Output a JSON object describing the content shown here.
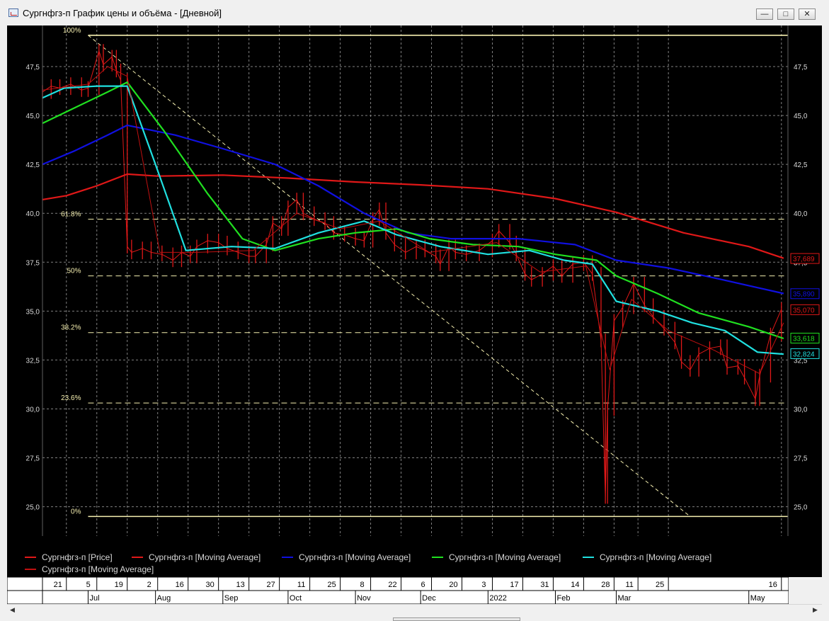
{
  "window": {
    "title": "Сургнфгз-п График цены и объёма - [Дневной]",
    "minimize_icon": "minimize-icon",
    "restore_icon": "restore-icon",
    "close_icon": "close-icon"
  },
  "colors": {
    "background": "#000000",
    "grid": "#808080",
    "price": "#e01818",
    "ma_red": "#e01818",
    "ma_blue": "#1010e0",
    "ma_green": "#20e020",
    "ma_cyan": "#20e0e0",
    "ma_darkred": "#c01010",
    "fib": "#f5efb0",
    "text": "#d8d8d8"
  },
  "chart_data": {
    "type": "line",
    "title": "",
    "y_ticks": [
      "47,5",
      "45,0",
      "42,5",
      "40,0",
      "37,5",
      "35,0",
      "32,5",
      "30,0",
      "27,5",
      "25,0"
    ],
    "y_tick_values": [
      47.5,
      45.0,
      42.5,
      40.0,
      37.5,
      35.0,
      32.5,
      30.0,
      27.5,
      25.0
    ],
    "ylim": [
      23.5,
      49.6
    ],
    "x_tick_days": [
      "21",
      "5",
      "19",
      "2",
      "16",
      "30",
      "13",
      "27",
      "11",
      "25",
      "8",
      "22",
      "6",
      "20",
      "3",
      "17",
      "31",
      "14",
      "28",
      "11",
      "25",
      "16"
    ],
    "x_tick_dates": [
      "2021-06-21",
      "2021-07-05",
      "2021-07-19",
      "2021-08-02",
      "2021-08-16",
      "2021-08-30",
      "2021-09-13",
      "2021-09-27",
      "2021-10-11",
      "2021-10-25",
      "2021-11-08",
      "2021-11-22",
      "2021-12-06",
      "2021-12-20",
      "2022-01-03",
      "2022-01-17",
      "2022-01-31",
      "2022-02-14",
      "2022-02-28",
      "2022-03-11",
      "2022-03-25",
      "2022-05-16"
    ],
    "x_months": [
      "Jul",
      "Aug",
      "Sep",
      "Oct",
      "Nov",
      "Dec",
      "2022",
      "Feb",
      "Mar",
      "May"
    ],
    "x_month_dates": [
      "2021-07-01",
      "2021-08-01",
      "2021-09-01",
      "2021-10-01",
      "2021-11-01",
      "2021-12-01",
      "2022-01-01",
      "2022-02-01",
      "2022-03-01",
      "2022-05-01"
    ],
    "x_range": [
      "2021-06-10",
      "2022-05-19"
    ],
    "fibonacci": {
      "levels": [
        {
          "label": "100%",
          "value": 49.1
        },
        {
          "label": "61.8%",
          "value": 39.7
        },
        {
          "label": "50%",
          "value": 36.8
        },
        {
          "label": "38.2%",
          "value": 33.9
        },
        {
          "label": "23.6%",
          "value": 30.3
        },
        {
          "label": "0%",
          "value": 24.5
        }
      ],
      "trend_line": [
        [
          "2021-07-01",
          49.1
        ],
        [
          "2022-04-04",
          24.5
        ]
      ]
    },
    "series": [
      {
        "name": "Сургнфгз-п [Price]",
        "color": "#e01818",
        "kind": "price",
        "points": [
          [
            "2021-06-10",
            46.2
          ],
          [
            "2021-06-14",
            46.5
          ],
          [
            "2021-06-18",
            46.4
          ],
          [
            "2021-06-23",
            46.6
          ],
          [
            "2021-06-28",
            46.3
          ],
          [
            "2021-07-01",
            46.4
          ],
          [
            "2021-07-06",
            48.3
          ],
          [
            "2021-07-08",
            47.6
          ],
          [
            "2021-07-12",
            48.0
          ],
          [
            "2021-07-14",
            47.3
          ],
          [
            "2021-07-16",
            46.8
          ],
          [
            "2021-07-19",
            38.3
          ],
          [
            "2021-07-21",
            38.0
          ],
          [
            "2021-07-26",
            38.2
          ],
          [
            "2021-07-30",
            38.0
          ],
          [
            "2021-08-04",
            37.9
          ],
          [
            "2021-08-09",
            37.6
          ],
          [
            "2021-08-13",
            38.0
          ],
          [
            "2021-08-17",
            37.8
          ],
          [
            "2021-08-20",
            38.3
          ],
          [
            "2021-08-25",
            38.6
          ],
          [
            "2021-08-30",
            38.5
          ],
          [
            "2021-09-03",
            38.2
          ],
          [
            "2021-09-08",
            38.0
          ],
          [
            "2021-09-13",
            37.8
          ],
          [
            "2021-09-16",
            37.8
          ],
          [
            "2021-09-21",
            38.4
          ],
          [
            "2021-09-24",
            39.5
          ],
          [
            "2021-09-28",
            39.2
          ],
          [
            "2021-10-01",
            40.3
          ],
          [
            "2021-10-05",
            40.7
          ],
          [
            "2021-10-08",
            40.0
          ],
          [
            "2021-10-13",
            39.7
          ],
          [
            "2021-10-18",
            39.5
          ],
          [
            "2021-10-22",
            39.0
          ],
          [
            "2021-10-27",
            38.9
          ],
          [
            "2021-11-01",
            38.7
          ],
          [
            "2021-11-05",
            38.6
          ],
          [
            "2021-11-09",
            39.7
          ],
          [
            "2021-11-12",
            40.2
          ],
          [
            "2021-11-15",
            39.0
          ],
          [
            "2021-11-19",
            38.4
          ],
          [
            "2021-11-24",
            38.0
          ],
          [
            "2021-11-29",
            38.3
          ],
          [
            "2021-12-03",
            38.1
          ],
          [
            "2021-12-08",
            37.8
          ],
          [
            "2021-12-10",
            37.4
          ],
          [
            "2021-12-14",
            38.3
          ],
          [
            "2021-12-17",
            38.0
          ],
          [
            "2021-12-22",
            37.9
          ],
          [
            "2021-12-28",
            38.1
          ],
          [
            "2022-01-03",
            38.6
          ],
          [
            "2022-01-06",
            39.1
          ],
          [
            "2022-01-11",
            38.5
          ],
          [
            "2022-01-14",
            37.9
          ],
          [
            "2022-01-18",
            36.9
          ],
          [
            "2022-01-21",
            36.6
          ],
          [
            "2022-01-26",
            36.9
          ],
          [
            "2022-01-31",
            37.3
          ],
          [
            "2022-02-04",
            36.8
          ],
          [
            "2022-02-09",
            37.4
          ],
          [
            "2022-02-14",
            37.5
          ],
          [
            "2022-02-18",
            36.9
          ],
          [
            "2022-02-22",
            33.5
          ],
          [
            "2022-02-24",
            25.5
          ],
          [
            "2022-02-25",
            30.0
          ],
          [
            "2022-02-28",
            34.5
          ],
          [
            "2022-03-04",
            35.2
          ],
          [
            "2022-03-09",
            36.4
          ],
          [
            "2022-03-14",
            35.3
          ],
          [
            "2022-03-18",
            34.7
          ],
          [
            "2022-03-23",
            34.1
          ],
          [
            "2022-03-28",
            33.4
          ],
          [
            "2022-03-31",
            32.4
          ],
          [
            "2022-04-04",
            32.0
          ],
          [
            "2022-04-08",
            32.8
          ],
          [
            "2022-04-13",
            33.1
          ],
          [
            "2022-04-18",
            33.2
          ],
          [
            "2022-04-21",
            32.1
          ],
          [
            "2022-04-26",
            32.2
          ],
          [
            "2022-04-29",
            31.6
          ],
          [
            "2022-05-04",
            30.5
          ],
          [
            "2022-05-06",
            31.7
          ],
          [
            "2022-05-11",
            33.8
          ],
          [
            "2022-05-16",
            35.1
          ]
        ]
      },
      {
        "name": "Сургнфгз-п [Moving Average]",
        "color": "#e01818",
        "kind": "ma",
        "points": [
          [
            "2021-06-10",
            40.7
          ],
          [
            "2021-06-21",
            40.9
          ],
          [
            "2021-07-05",
            41.4
          ],
          [
            "2021-07-19",
            42.0
          ],
          [
            "2021-08-02",
            41.9
          ],
          [
            "2021-09-01",
            41.95
          ],
          [
            "2021-10-01",
            41.8
          ],
          [
            "2021-11-01",
            41.6
          ],
          [
            "2021-12-01",
            41.45
          ],
          [
            "2022-01-01",
            41.25
          ],
          [
            "2022-02-01",
            40.75
          ],
          [
            "2022-03-01",
            40.05
          ],
          [
            "2022-04-01",
            39.0
          ],
          [
            "2022-05-01",
            38.3
          ],
          [
            "2022-05-17",
            37.7
          ]
        ]
      },
      {
        "name": "Сургнфгз-п [Moving Average]",
        "color": "#1010e0",
        "kind": "ma",
        "points": [
          [
            "2021-06-10",
            42.5
          ],
          [
            "2021-06-25",
            43.2
          ],
          [
            "2021-07-10",
            44.0
          ],
          [
            "2021-07-19",
            44.5
          ],
          [
            "2021-08-10",
            44.0
          ],
          [
            "2021-09-01",
            43.3
          ],
          [
            "2021-09-25",
            42.5
          ],
          [
            "2021-10-15",
            41.4
          ],
          [
            "2021-11-05",
            40.0
          ],
          [
            "2021-11-25",
            39.0
          ],
          [
            "2021-12-15",
            38.7
          ],
          [
            "2022-01-15",
            38.7
          ],
          [
            "2022-02-10",
            38.4
          ],
          [
            "2022-03-01",
            37.6
          ],
          [
            "2022-03-25",
            37.2
          ],
          [
            "2022-04-15",
            36.7
          ],
          [
            "2022-05-01",
            36.3
          ],
          [
            "2022-05-17",
            35.9
          ]
        ]
      },
      {
        "name": "Сургнфгз-п [Moving Average]",
        "color": "#20e020",
        "kind": "ma",
        "points": [
          [
            "2021-06-10",
            44.6
          ],
          [
            "2021-06-25",
            45.4
          ],
          [
            "2021-07-10",
            46.2
          ],
          [
            "2021-07-19",
            46.7
          ],
          [
            "2021-08-05",
            44.2
          ],
          [
            "2021-08-25",
            41.0
          ],
          [
            "2021-09-10",
            38.7
          ],
          [
            "2021-09-25",
            38.1
          ],
          [
            "2021-10-15",
            38.7
          ],
          [
            "2021-11-01",
            39.0
          ],
          [
            "2021-11-20",
            39.2
          ],
          [
            "2021-12-05",
            38.7
          ],
          [
            "2021-12-25",
            38.4
          ],
          [
            "2022-01-15",
            38.3
          ],
          [
            "2022-02-01",
            37.9
          ],
          [
            "2022-02-20",
            37.6
          ],
          [
            "2022-03-01",
            36.8
          ],
          [
            "2022-03-20",
            35.9
          ],
          [
            "2022-04-08",
            34.9
          ],
          [
            "2022-05-01",
            34.2
          ],
          [
            "2022-05-17",
            33.6
          ]
        ]
      },
      {
        "name": "Сургнфгз-п [Moving Average]",
        "color": "#20e0e0",
        "kind": "ma",
        "points": [
          [
            "2021-06-10",
            45.9
          ],
          [
            "2021-06-20",
            46.4
          ],
          [
            "2021-07-05",
            46.5
          ],
          [
            "2021-07-19",
            46.5
          ],
          [
            "2021-08-01",
            42.5
          ],
          [
            "2021-08-15",
            38.1
          ],
          [
            "2021-09-05",
            38.3
          ],
          [
            "2021-09-25",
            38.2
          ],
          [
            "2021-10-15",
            39.0
          ],
          [
            "2021-11-05",
            39.6
          ],
          [
            "2021-11-20",
            38.9
          ],
          [
            "2021-12-10",
            38.3
          ],
          [
            "2022-01-01",
            37.9
          ],
          [
            "2022-01-20",
            38.1
          ],
          [
            "2022-02-05",
            37.6
          ],
          [
            "2022-02-18",
            37.4
          ],
          [
            "2022-03-01",
            35.5
          ],
          [
            "2022-03-20",
            35.0
          ],
          [
            "2022-04-05",
            34.4
          ],
          [
            "2022-04-20",
            34.0
          ],
          [
            "2022-05-05",
            32.9
          ],
          [
            "2022-05-17",
            32.8
          ]
        ]
      },
      {
        "name": "Сургнфгз-п [Moving Average]",
        "color": "#c01010",
        "kind": "ma_thin",
        "points": [
          [
            "2021-06-10",
            46.3
          ],
          [
            "2021-07-01",
            46.6
          ],
          [
            "2021-07-10",
            47.5
          ],
          [
            "2021-07-19",
            47.0
          ],
          [
            "2021-08-03",
            38.0
          ],
          [
            "2021-08-20",
            38.0
          ],
          [
            "2021-09-15",
            38.1
          ],
          [
            "2021-10-05",
            40.0
          ],
          [
            "2021-10-25",
            39.2
          ],
          [
            "2021-11-12",
            39.6
          ],
          [
            "2021-12-05",
            38.0
          ],
          [
            "2022-01-05",
            38.5
          ],
          [
            "2022-01-25",
            37.0
          ],
          [
            "2022-02-15",
            37.3
          ],
          [
            "2022-02-26",
            32.0
          ],
          [
            "2022-03-08",
            35.6
          ],
          [
            "2022-03-25",
            34.0
          ],
          [
            "2022-04-15",
            33.0
          ],
          [
            "2022-05-06",
            31.8
          ],
          [
            "2022-05-17",
            34.4
          ]
        ]
      }
    ],
    "last_values": [
      {
        "label": "37,689",
        "value": 37.689,
        "color": "#e01818"
      },
      {
        "label": "35,890",
        "value": 35.89,
        "color": "#1010e0"
      },
      {
        "label": "35,070",
        "value": 35.07,
        "color": "#e01818"
      },
      {
        "label": "33,618",
        "value": 33.618,
        "color": "#20e020"
      },
      {
        "label": "32,824",
        "value": 32.824,
        "color": "#20e0e0"
      }
    ],
    "legend": [
      {
        "label": "Сургнфгз-п [Price]",
        "color": "#e01818"
      },
      {
        "label": "Сургнфгз-п [Moving Average]",
        "color": "#e01818"
      },
      {
        "label": "Сургнфгз-п [Moving Average]",
        "color": "#1010e0"
      },
      {
        "label": "Сургнфгз-п [Moving Average]",
        "color": "#20e020"
      },
      {
        "label": "Сургнфгз-п [Moving Average]",
        "color": "#20e0e0"
      },
      {
        "label": "Сургнфгз-п [Moving Average]",
        "color": "#c01010"
      }
    ]
  }
}
